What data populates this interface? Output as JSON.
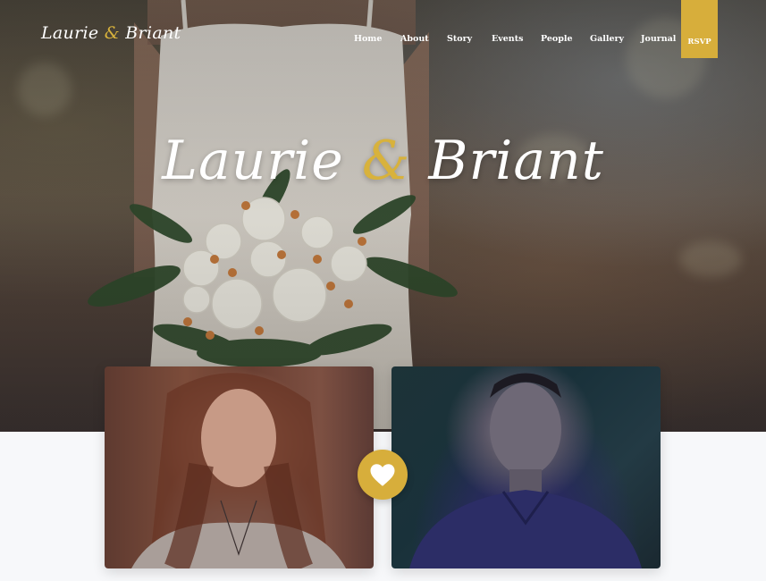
{
  "header": {
    "logo": {
      "left_name": "Laurie",
      "amp": "&",
      "right_name": "Briant"
    },
    "nav": [
      "Home",
      "About",
      "Story",
      "Events",
      "People",
      "Gallery",
      "Journal"
    ],
    "rsvp_label": "RSVP"
  },
  "hero": {
    "title": {
      "left_name": "Laurie",
      "amp": "&",
      "right_name": "Briant"
    }
  },
  "colors": {
    "accent": "#d7ae3b",
    "text_light": "#ffffff",
    "background": "#f7f8fa"
  },
  "icons": {
    "heart": "heart-icon"
  }
}
